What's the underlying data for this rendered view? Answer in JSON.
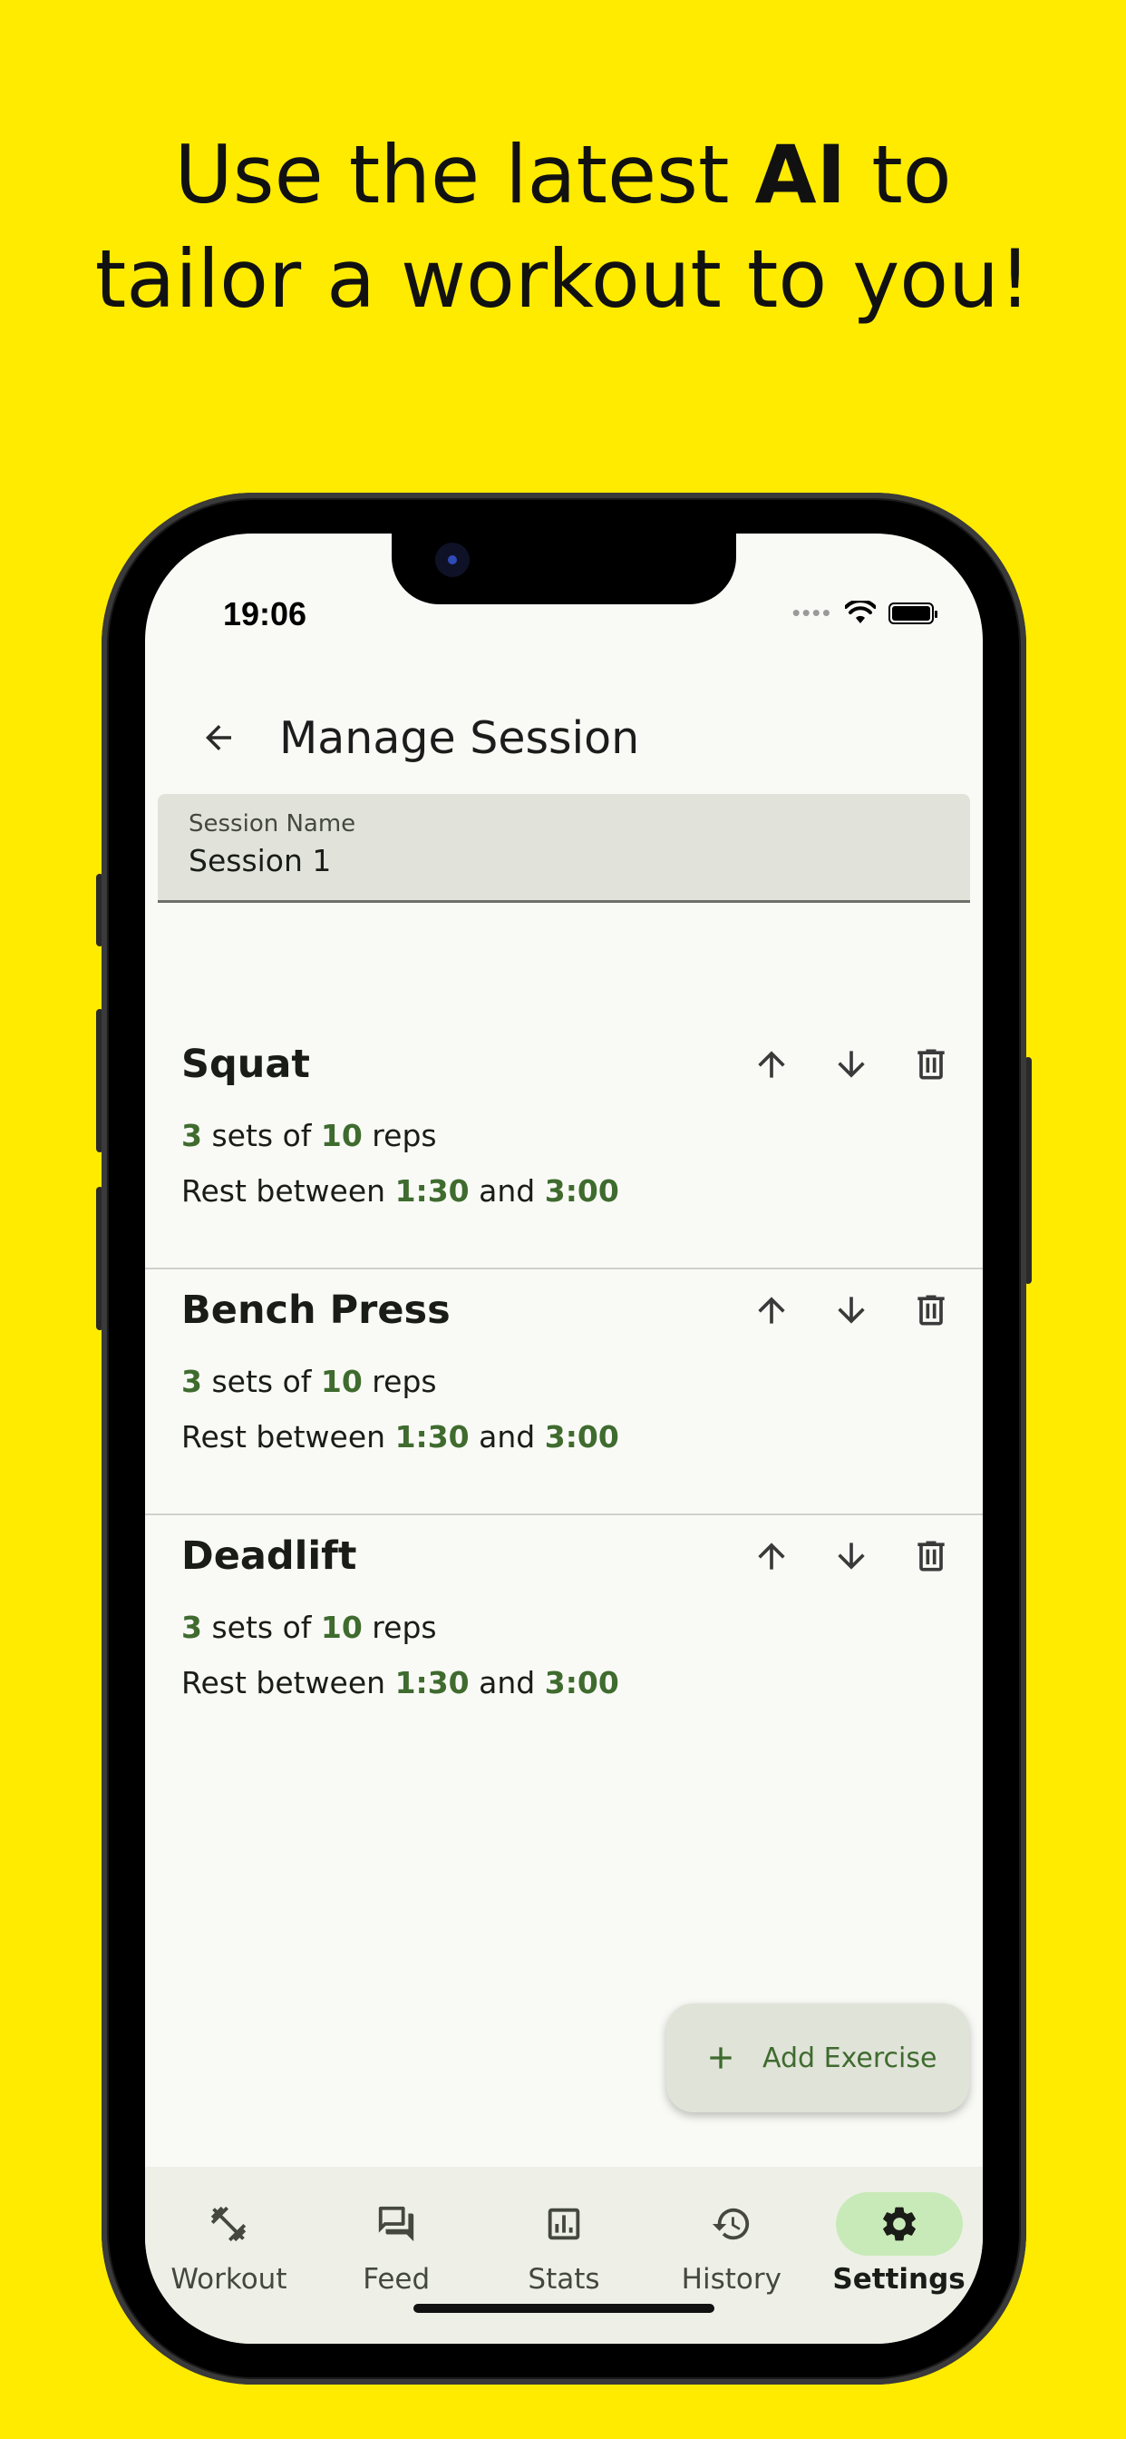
{
  "headline": {
    "line1_pre": "Use the latest ",
    "line1_bold": "AI",
    "line1_post": " to",
    "line2": "tailor a workout to you!"
  },
  "status_bar": {
    "time": "19:06",
    "dots": "••••"
  },
  "header": {
    "title": "Manage Session",
    "back_icon": "arrow-back-icon"
  },
  "session_field": {
    "label": "Session Name",
    "value": "Session 1"
  },
  "exercises": [
    {
      "name": "Squat",
      "sets": "3",
      "sets_text": " sets of ",
      "reps": "10",
      "reps_text": " reps",
      "rest_prefix": "Rest between ",
      "rest_min": "1:30",
      "rest_and": " and ",
      "rest_max": "3:00"
    },
    {
      "name": "Bench Press",
      "sets": "3",
      "sets_text": " sets of ",
      "reps": "10",
      "reps_text": " reps",
      "rest_prefix": "Rest between ",
      "rest_min": "1:30",
      "rest_and": " and ",
      "rest_max": "3:00"
    },
    {
      "name": "Deadlift",
      "sets": "3",
      "sets_text": " sets of ",
      "reps": "10",
      "reps_text": " reps",
      "rest_prefix": "Rest between ",
      "rest_min": "1:30",
      "rest_and": " and ",
      "rest_max": "3:00"
    }
  ],
  "fab": {
    "label": "Add Exercise",
    "icon": "plus-icon"
  },
  "nav": [
    {
      "label": "Workout",
      "icon": "dumbbell-icon",
      "active": false
    },
    {
      "label": "Feed",
      "icon": "forum-icon",
      "active": false
    },
    {
      "label": "Stats",
      "icon": "chart-icon",
      "active": false
    },
    {
      "label": "History",
      "icon": "history-icon",
      "active": false
    },
    {
      "label": "Settings",
      "icon": "gear-icon",
      "active": true
    }
  ],
  "colors": {
    "background": "#FFEB00",
    "accent_green": "#3f6b2f",
    "active_pill": "#C8EAB8",
    "screen": "#F9FAF5"
  }
}
